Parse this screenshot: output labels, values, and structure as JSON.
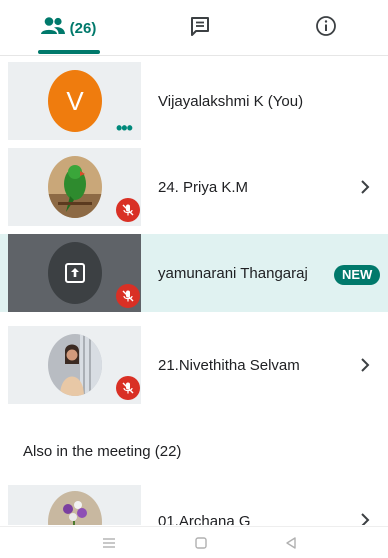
{
  "tabs": {
    "people": {
      "count": "(26)",
      "icon": "people-icon",
      "active": true
    },
    "chat": {
      "icon": "chat-icon"
    },
    "info": {
      "icon": "info-icon"
    }
  },
  "participants": [
    {
      "name": "Vijayalakshmi K (You)",
      "initial": "V",
      "avatar_color": "#ef7c0e",
      "muted": false,
      "more": true
    },
    {
      "name": "24. Priya K.M",
      "muted": true,
      "chevron": true,
      "avatar": "parrot-photo"
    },
    {
      "name": "yamunarani Thangaraj",
      "muted": true,
      "presenting": true,
      "badge": "NEW",
      "avatar": "present-screen-icon"
    },
    {
      "name": "21.Nivethitha Selvam",
      "muted": true,
      "chevron": true,
      "avatar": "person-photo"
    }
  ],
  "also_in_meeting": {
    "heading": "Also in the meeting (22)",
    "first": {
      "name": "01.Archana G",
      "avatar": "flowers-photo"
    }
  },
  "colors": {
    "accent": "#00796b",
    "muted_red": "#d93025",
    "highlight_row": "#e0f2f1"
  },
  "navbar": {
    "icons": [
      "menu-icon",
      "home-icon",
      "back-icon"
    ]
  }
}
